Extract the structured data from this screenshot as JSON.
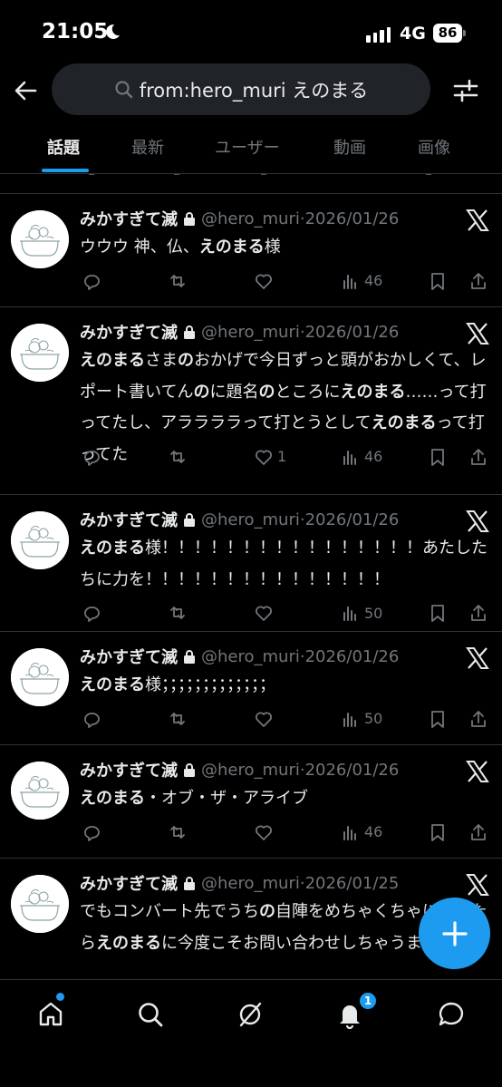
{
  "status_bar": {
    "time": "21:05",
    "network": "4G",
    "battery": "86"
  },
  "header": {
    "search_query": "from:hero_muri えのまる"
  },
  "tabs": [
    {
      "label": "話題",
      "active": true
    },
    {
      "label": "最新",
      "active": false
    },
    {
      "label": "ユーザー",
      "active": false
    },
    {
      "label": "動画",
      "active": false
    },
    {
      "label": "画像",
      "active": false
    }
  ],
  "tweets": [
    {
      "name": "みかすぎて滅",
      "handle": "@hero_muri·2026/01/26",
      "text_html": "ウウウ 神、仏、<b>えのまる</b>様",
      "likes": "",
      "views": "46"
    },
    {
      "name": "みかすぎて滅",
      "handle": "@hero_muri·2026/01/26",
      "text_html": "<b>えのまる</b>さま<b>の</b>おかげで今日ずっと頭がおかしくて、レポート書いてん<b>の</b>に題名<b>の</b>ところに<b>えのまる</b>……って打ってたし、アララララって打とうとして<b>えのまる</b>って打ってた",
      "likes": "1",
      "views": "46"
    },
    {
      "name": "みかすぎて滅",
      "handle": "@hero_muri·2026/01/26",
      "text_html": "<b>えのまる</b>様！！！！！！！！！！！！！！！！あたしたちに力を！！！！！！！！！！！！！！！",
      "likes": "",
      "views": "50"
    },
    {
      "name": "みかすぎて滅",
      "handle": "@hero_muri·2026/01/26",
      "text_html": "<b>えのまる</b>様；；；；；；；；；；；；；",
      "likes": "",
      "views": "50"
    },
    {
      "name": "みかすぎて滅",
      "handle": "@hero_muri·2026/01/26",
      "text_html": "<b>えのまる</b>・オブ・ザ・アライブ",
      "likes": "",
      "views": "46"
    },
    {
      "name": "みかすぎて滅",
      "handle": "@hero_muri·2026/01/25",
      "text_html": "でもコンバート先でうち<b>の</b>自陣をめちゃくちゃにされたら<b>えのまる</b>に今度こそお問い合わせしちゃうまう ギー",
      "likes": "",
      "views": ""
    }
  ],
  "bottom_nav": {
    "notification_count": "1"
  },
  "colors": {
    "accent": "#1d9bf0",
    "background": "#000000",
    "secondary_text": "#71767b"
  }
}
